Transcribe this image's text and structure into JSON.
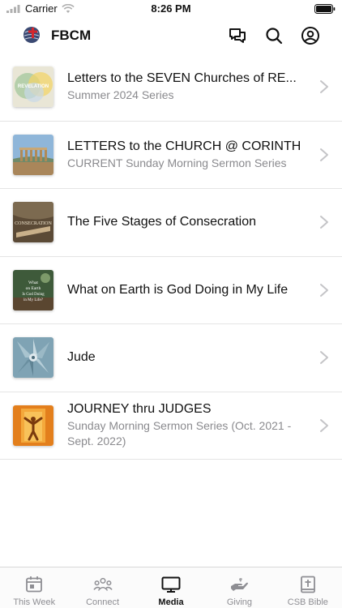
{
  "status_bar": {
    "carrier": "Carrier",
    "time": "8:26 PM"
  },
  "header": {
    "app_name": "FBCM"
  },
  "series": [
    {
      "title": "Letters to the SEVEN Churches of RE...",
      "subtitle": "Summer 2024 Series",
      "thumb_text": "REVELATION"
    },
    {
      "title": "LETTERS to the CHURCH @ CORINTH",
      "subtitle": "CURRENT Sunday Morning Sermon Series"
    },
    {
      "title": "The Five Stages of Consecration",
      "subtitle": "",
      "thumb_text": "CONSECRATION"
    },
    {
      "title": "What on Earth is God Doing in My Life",
      "subtitle": "",
      "thumb_text": "What on Earth Is God Doing in My Life?"
    },
    {
      "title": "Jude",
      "subtitle": ""
    },
    {
      "title": "JOURNEY thru JUDGES",
      "subtitle": "Sunday Morning Sermon Series (Oct. 2021 - Sept. 2022)"
    }
  ],
  "tabs": [
    {
      "label": "This Week",
      "icon": "calendar-icon"
    },
    {
      "label": "Connect",
      "icon": "people-icon"
    },
    {
      "label": "Media",
      "icon": "tv-icon",
      "active": true
    },
    {
      "label": "Giving",
      "icon": "hand-icon"
    },
    {
      "label": "CSB Bible",
      "icon": "bible-icon"
    }
  ]
}
